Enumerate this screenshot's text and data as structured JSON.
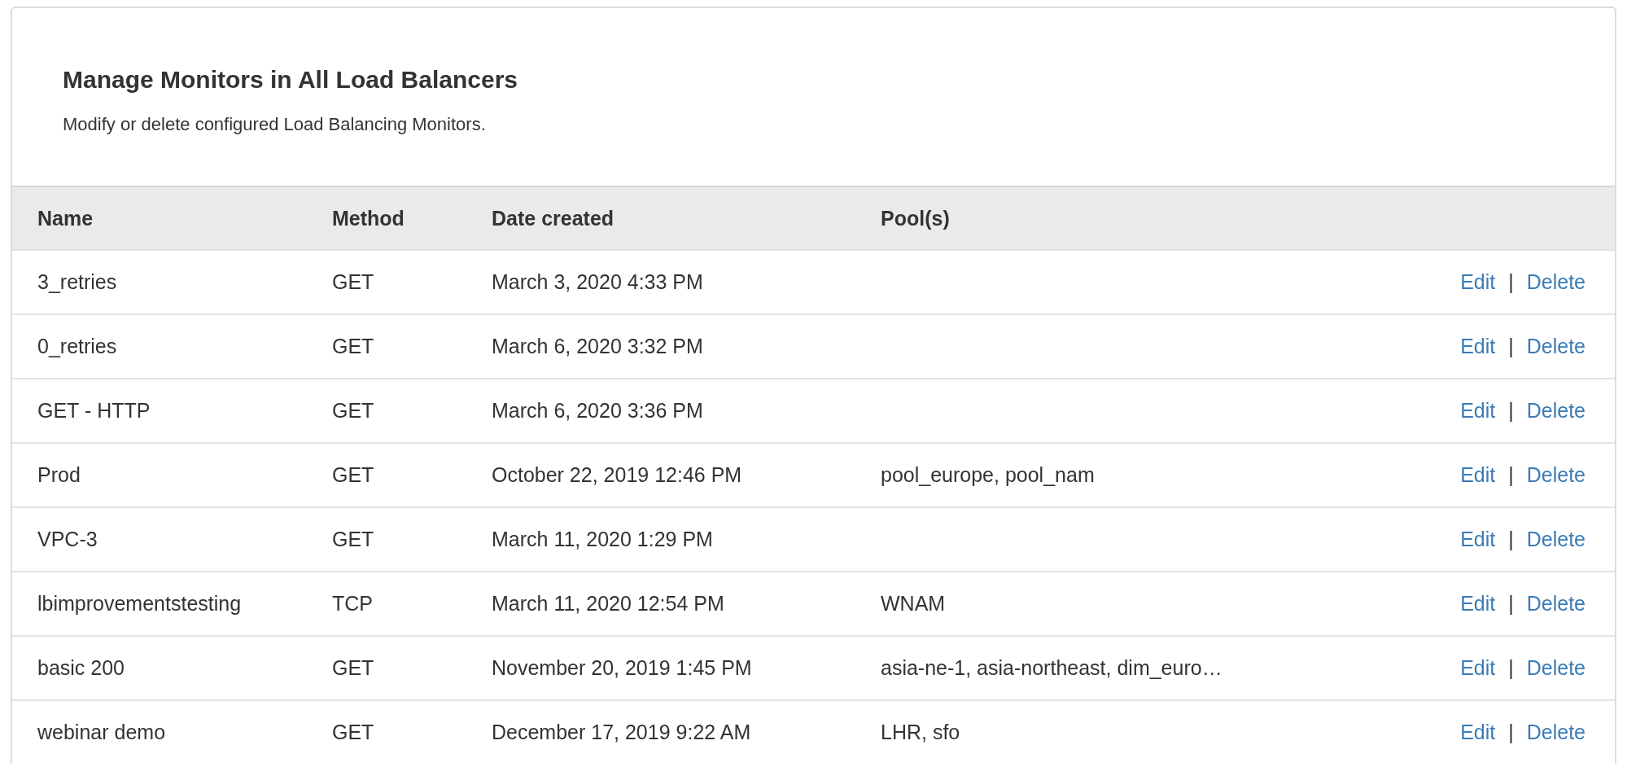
{
  "header": {
    "title": "Manage Monitors in All Load Balancers",
    "description": "Modify or delete configured Load Balancing Monitors."
  },
  "table": {
    "columns": [
      "Name",
      "Method",
      "Date created",
      "Pool(s)"
    ],
    "rows": [
      {
        "name": "3_retries",
        "method": "GET",
        "date_created": "March 3, 2020 4:33 PM",
        "pools": "",
        "actions": [
          "Edit",
          "|",
          "Delete"
        ]
      },
      {
        "name": "0_retries",
        "method": "GET",
        "date_created": "March 6, 2020 3:32 PM",
        "pools": "",
        "actions": [
          "Edit",
          "|",
          "Delete"
        ]
      },
      {
        "name": "GET - HTTP",
        "method": "GET",
        "date_created": "March 6, 2020 3:36 PM",
        "pools": "",
        "actions": [
          "Edit",
          "|",
          "Delete"
        ]
      },
      {
        "name": "Prod",
        "method": "GET",
        "date_created": "October 22, 2019 12:46 PM",
        "pools": "pool_europe, pool_nam",
        "actions": [
          "Edit",
          "|",
          "Delete"
        ]
      },
      {
        "name": "VPC-3",
        "method": "GET",
        "date_created": "March 11, 2020 1:29 PM",
        "pools": "",
        "actions": [
          "Edit",
          "|",
          "Delete"
        ]
      },
      {
        "name": "lbimprovementstesting",
        "method": "TCP",
        "date_created": "March 11, 2020 12:54 PM",
        "pools": "WNAM",
        "actions": [
          "Edit",
          "|",
          "Delete"
        ]
      },
      {
        "name": "basic 200",
        "method": "GET",
        "date_created": "November 20, 2019 1:45 PM",
        "pools": "asia-ne-1, asia-northeast, dim_euro…",
        "actions": [
          "Edit",
          "|",
          "Delete"
        ]
      },
      {
        "name": "webinar demo",
        "method": "GET",
        "date_created": "December 17, 2019 9:22 AM",
        "pools": "LHR, sfo",
        "actions": [
          "Edit",
          "|",
          "Delete"
        ]
      }
    ]
  }
}
